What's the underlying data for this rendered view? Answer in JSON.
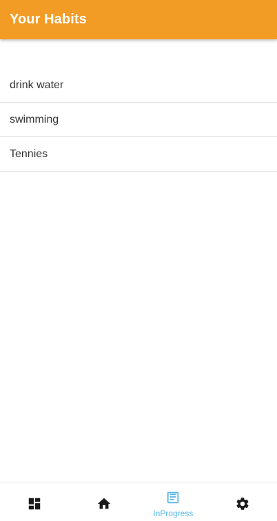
{
  "appbar": {
    "title": "Your Habits",
    "color": "#f29b25"
  },
  "habits": [
    {
      "label": "drink water"
    },
    {
      "label": "swimming"
    },
    {
      "label": "Tennies"
    }
  ],
  "bottom_nav": {
    "active_color": "#58b8e6",
    "inactive_color": "#1a1a1a",
    "items": [
      {
        "icon": "dashboard-icon",
        "label": "",
        "active": false
      },
      {
        "icon": "home-icon",
        "label": "",
        "active": false
      },
      {
        "icon": "inprogress-icon",
        "label": "InProgress",
        "active": true
      },
      {
        "icon": "gear-icon",
        "label": "",
        "active": false
      }
    ]
  }
}
